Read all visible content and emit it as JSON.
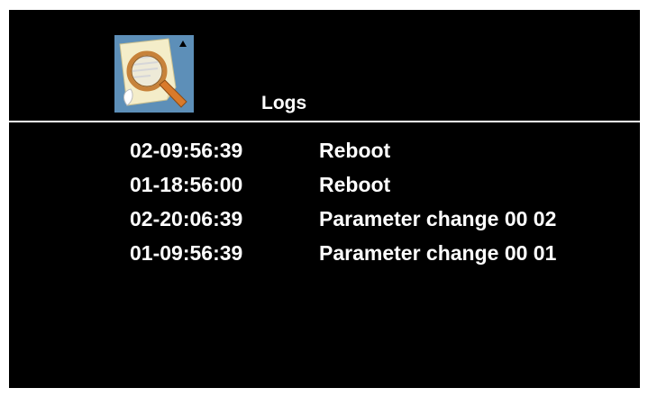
{
  "header": {
    "title": "Logs",
    "icon": "magnifier-document-icon"
  },
  "colors": {
    "background": "#000000",
    "text": "#ffffff",
    "icon_background": "#5d8fb8",
    "icon_handle": "#d97a2b"
  },
  "logs": [
    {
      "time": "02-09:56:39",
      "event": "Reboot"
    },
    {
      "time": "01-18:56:00",
      "event": "Reboot"
    },
    {
      "time": "02-20:06:39",
      "event": "Parameter change 00 02"
    },
    {
      "time": "01-09:56:39",
      "event": "Parameter change 00 01"
    }
  ]
}
